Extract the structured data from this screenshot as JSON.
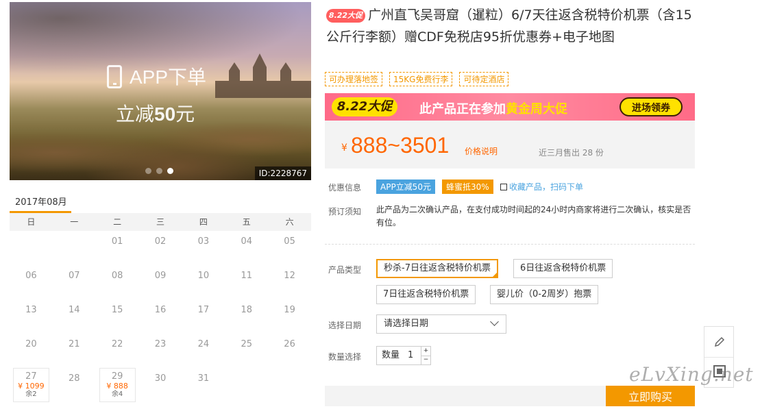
{
  "hero": {
    "app_text": "APP下单",
    "promo_prefix": "立减",
    "promo_amount": "50",
    "promo_suffix": "元",
    "id_badge": "ID:2228767"
  },
  "calendar": {
    "month": "2017年08月",
    "weekdays": [
      "日",
      "一",
      "二",
      "三",
      "四",
      "五",
      "六"
    ],
    "cells": [
      {
        "day": "",
        "price": "",
        "left": ""
      },
      {
        "day": "",
        "price": "",
        "left": ""
      },
      {
        "day": "01",
        "price": "",
        "left": ""
      },
      {
        "day": "02",
        "price": "",
        "left": ""
      },
      {
        "day": "03",
        "price": "",
        "left": ""
      },
      {
        "day": "04",
        "price": "",
        "left": ""
      },
      {
        "day": "05",
        "price": "",
        "left": ""
      },
      {
        "day": "06",
        "price": "",
        "left": ""
      },
      {
        "day": "07",
        "price": "",
        "left": ""
      },
      {
        "day": "08",
        "price": "",
        "left": ""
      },
      {
        "day": "09",
        "price": "",
        "left": ""
      },
      {
        "day": "10",
        "price": "",
        "left": ""
      },
      {
        "day": "11",
        "price": "",
        "left": ""
      },
      {
        "day": "12",
        "price": "",
        "left": ""
      },
      {
        "day": "13",
        "price": "",
        "left": ""
      },
      {
        "day": "14",
        "price": "",
        "left": ""
      },
      {
        "day": "15",
        "price": "",
        "left": ""
      },
      {
        "day": "16",
        "price": "",
        "left": ""
      },
      {
        "day": "17",
        "price": "",
        "left": ""
      },
      {
        "day": "18",
        "price": "",
        "left": ""
      },
      {
        "day": "19",
        "price": "",
        "left": ""
      },
      {
        "day": "20",
        "price": "",
        "left": ""
      },
      {
        "day": "21",
        "price": "",
        "left": ""
      },
      {
        "day": "22",
        "price": "",
        "left": ""
      },
      {
        "day": "23",
        "price": "",
        "left": ""
      },
      {
        "day": "24",
        "price": "",
        "left": ""
      },
      {
        "day": "25",
        "price": "",
        "left": ""
      },
      {
        "day": "26",
        "price": "",
        "left": ""
      },
      {
        "day": "27",
        "price": "¥ 1099",
        "left": "余2"
      },
      {
        "day": "28",
        "price": "",
        "left": ""
      },
      {
        "day": "29",
        "price": "¥ 888",
        "left": "余4"
      },
      {
        "day": "30",
        "price": "",
        "left": ""
      },
      {
        "day": "31",
        "price": "",
        "left": ""
      }
    ]
  },
  "product": {
    "badge": "8.22大促",
    "title": "广州直飞吴哥窟（暹粒）6/7天往返含税特价机票（含15公斤行李额）赠CDF免税店95折优惠券+电子地图",
    "tags": [
      "可办理落地签",
      "15KG免费行李",
      "可待定酒店"
    ]
  },
  "banner": {
    "badge": "8.22大促",
    "text_prefix": "此产品正在参加",
    "text_highlight": "黄金周大促",
    "button": "进场领券"
  },
  "price": {
    "currency": "¥",
    "amount": "888~3501",
    "desc_link": "价格说明",
    "sold": "近三月售出 28 份"
  },
  "info": {
    "promo_label": "优惠信息",
    "promo_app": "APP立减50元",
    "promo_bee": "蜂蜜抵30%",
    "fav": "收藏产品，扫码下单",
    "notice_label": "预订须知",
    "notice_text": "此产品为二次确认产品，在支付成功时间起的24小时内商家将进行二次确认，核实是否有位。"
  },
  "options": {
    "type_label": "产品类型",
    "types": [
      "秒杀-7日往返含税特价机票",
      "6日往返含税特价机票",
      "7日往返含税特价机票",
      "婴儿价（0-2周岁）抱票"
    ],
    "selected_index": 0,
    "date_label": "选择日期",
    "date_value": "请选择日期",
    "qty_label": "数量选择",
    "qty_prefix": "数量",
    "qty_value": "1",
    "book_button": "立即购买"
  },
  "watermark": "eLvXing.net"
}
